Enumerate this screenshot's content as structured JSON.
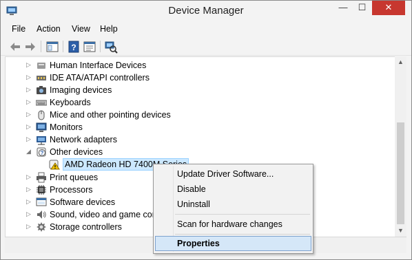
{
  "window": {
    "title": "Device Manager",
    "controls": {
      "minimize": "—",
      "maximize": "☐",
      "close": "✕"
    }
  },
  "menubar": [
    "File",
    "Action",
    "View",
    "Help"
  ],
  "toolbar": {
    "icons": [
      "back-arrow-icon",
      "forward-arrow-icon",
      "show-hide-console-tree-icon",
      "help-icon",
      "properties-icon",
      "scan-hardware-icon"
    ]
  },
  "tree": {
    "rows": [
      {
        "label": "Human Interface Devices",
        "icon": "hid-icon",
        "expanded": false
      },
      {
        "label": "IDE ATA/ATAPI controllers",
        "icon": "ide-controller-icon",
        "expanded": false
      },
      {
        "label": "Imaging devices",
        "icon": "camera-icon",
        "expanded": false
      },
      {
        "label": "Keyboards",
        "icon": "keyboard-icon",
        "expanded": false
      },
      {
        "label": "Mice and other pointing devices",
        "icon": "mouse-icon",
        "expanded": false
      },
      {
        "label": "Monitors",
        "icon": "monitor-icon",
        "expanded": false
      },
      {
        "label": "Network adapters",
        "icon": "network-adapter-icon",
        "expanded": false
      },
      {
        "label": "Other devices",
        "icon": "unknown-device-icon",
        "expanded": true
      },
      {
        "label": "AMD Radeon HD 7400M Series",
        "icon": "warning-device-icon",
        "child": true,
        "selected": true
      },
      {
        "label": "Print queues",
        "icon": "printer-icon",
        "expanded": false
      },
      {
        "label": "Processors",
        "icon": "processor-icon",
        "expanded": false
      },
      {
        "label": "Software devices",
        "icon": "software-device-icon",
        "expanded": false
      },
      {
        "label": "Sound, video and game controllers",
        "icon": "speaker-icon",
        "expanded": false
      },
      {
        "label": "Storage controllers",
        "icon": "storage-controller-icon",
        "expanded": false
      }
    ]
  },
  "context_menu": {
    "items": [
      {
        "label": "Update Driver Software...",
        "highlighted": false
      },
      {
        "label": "Disable",
        "highlighted": false
      },
      {
        "label": "Uninstall",
        "highlighted": false
      },
      {
        "label": "Scan for hardware changes",
        "highlighted": false
      },
      {
        "label": "Properties",
        "highlighted": true
      }
    ]
  },
  "colors": {
    "close_button": "#c7372f",
    "selection": "#cce8ff",
    "menu_highlight": "#d5e7f8"
  }
}
